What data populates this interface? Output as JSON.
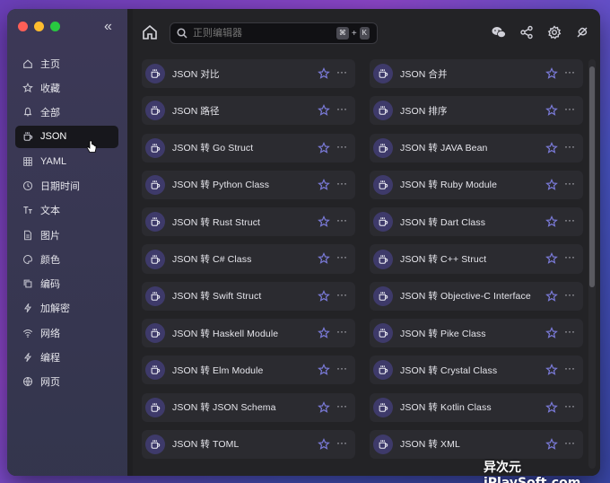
{
  "search": {
    "placeholder": "正则编辑器",
    "shortcut_key1": "⌘",
    "shortcut_plus": "+",
    "shortcut_key2": "K"
  },
  "sidebar": {
    "collapse_glyph": "«",
    "items": [
      {
        "label": "主页",
        "icon": "home-icon",
        "active": false
      },
      {
        "label": "收藏",
        "icon": "star-icon",
        "active": false
      },
      {
        "label": "全部",
        "icon": "bell-icon",
        "active": false
      },
      {
        "label": "JSON",
        "icon": "cup-icon",
        "active": true
      },
      {
        "label": "YAML",
        "icon": "grid-icon",
        "active": false
      },
      {
        "label": "日期时间",
        "icon": "clock-icon",
        "active": false
      },
      {
        "label": "文本",
        "icon": "text-icon",
        "active": false
      },
      {
        "label": "图片",
        "icon": "file-icon",
        "active": false
      },
      {
        "label": "颜色",
        "icon": "palette-icon",
        "active": false
      },
      {
        "label": "编码",
        "icon": "copy-icon",
        "active": false
      },
      {
        "label": "加解密",
        "icon": "bolt-icon",
        "active": false
      },
      {
        "label": "网络",
        "icon": "wifi-icon",
        "active": false
      },
      {
        "label": "编程",
        "icon": "lightning-icon",
        "active": false
      },
      {
        "label": "网页",
        "icon": "globe-icon",
        "active": false
      }
    ]
  },
  "toolbar": {
    "icons": [
      "home-icon",
      "wechat-icon",
      "share-icon",
      "settings-icon",
      "pin-icon"
    ]
  },
  "tools": [
    {
      "label": "JSON 对比"
    },
    {
      "label": "JSON 合并"
    },
    {
      "label": "JSON 路径"
    },
    {
      "label": "JSON 排序"
    },
    {
      "label": "JSON 转 Go Struct"
    },
    {
      "label": "JSON 转 JAVA Bean"
    },
    {
      "label": "JSON 转 Python Class"
    },
    {
      "label": "JSON 转 Ruby Module"
    },
    {
      "label": "JSON 转 Rust Struct"
    },
    {
      "label": "JSON 转 Dart Class"
    },
    {
      "label": "JSON 转 C# Class"
    },
    {
      "label": "JSON 转 C++ Struct"
    },
    {
      "label": "JSON 转 Swift Struct"
    },
    {
      "label": "JSON 转 Objective-C Interface"
    },
    {
      "label": "JSON 转 Haskell Module"
    },
    {
      "label": "JSON 转 Pike Class"
    },
    {
      "label": "JSON 转 Elm Module"
    },
    {
      "label": "JSON 转 Crystal Class"
    },
    {
      "label": "JSON 转 JSON Schema"
    },
    {
      "label": "JSON 转 Kotlin Class"
    },
    {
      "label": "JSON 转 TOML"
    },
    {
      "label": "JSON 转 XML"
    }
  ],
  "card_more": "···",
  "watermark": "异次元 iPlaySoft.com",
  "colors": {
    "accent": "#7a7ad8",
    "card_bg": "#2b2b30",
    "active_nav": "#17171c"
  }
}
